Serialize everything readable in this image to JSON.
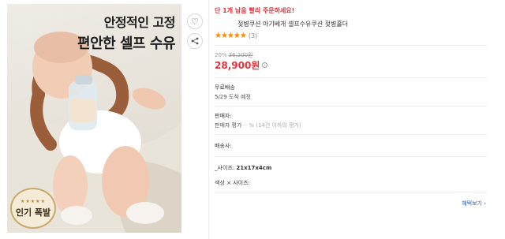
{
  "product_image": {
    "headline_line1": "안정적인 고정",
    "headline_line2": "편안한 셀프 수유",
    "badge_text": "인기 폭발",
    "badge_stars": "★★★★★"
  },
  "icons": {
    "wishlist": "heart-icon",
    "share": "share-icon"
  },
  "promo_text": "단 1개 남음 빨리 주문하세요!",
  "title": "젖병쿠션 아기베개 셀프수유쿠션 젖병홀더",
  "rating": {
    "stars_text": "★★★★★",
    "value": 5,
    "count_text": "(3)"
  },
  "pricing": {
    "discount_percent": "20%",
    "original_price": "36,200원",
    "price": "28,900원"
  },
  "shipping": {
    "label": "무료배송",
    "date": "5/29 도착 예정"
  },
  "seller": {
    "label": "판매자:",
    "rating_text": "판매자 평가",
    "rating_detail": "·· % (14건 이하의 평가)"
  },
  "delivery_company": {
    "label": "배송사:"
  },
  "size_row": {
    "label": "_사이즈:",
    "value": "21x17x4cm"
  },
  "options_row": {
    "label": "색상 × 사이즈:"
  },
  "more_link": "혜택보기",
  "colors": {
    "accent_red": "#e0343c",
    "star_orange": "#ff8a00",
    "link_blue": "#2a62c9"
  }
}
